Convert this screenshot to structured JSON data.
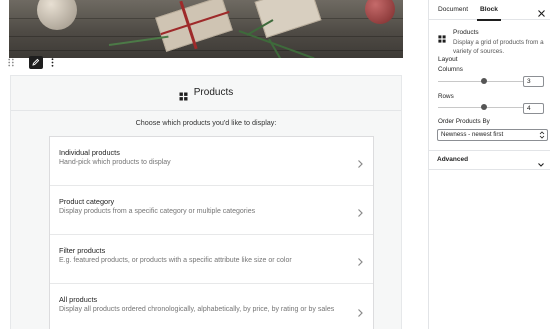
{
  "block": {
    "title": "Products",
    "instruction": "Choose which products you'd like to display:"
  },
  "options": [
    {
      "title": "Individual products",
      "description": "Hand-pick which products to display"
    },
    {
      "title": "Product category",
      "description": "Display products from a specific category or multiple categories"
    },
    {
      "title": "Filter products",
      "description": "E.g. featured products, or products with a specific attribute like size or color"
    },
    {
      "title": "All products",
      "description": "Display all products ordered chronologically, alphabetically, by price, by rating or by sales"
    }
  ],
  "sidebar": {
    "tabs": {
      "document": "Document",
      "block": "Block"
    },
    "block_card": {
      "title": "Products",
      "description": "Display a grid of products from a variety of sources."
    },
    "layout": {
      "title": "Layout",
      "columns_label": "Columns",
      "columns_value": "3",
      "columns_level": 0.45,
      "rows_label": "Rows",
      "rows_value": "4",
      "rows_level": 0.45
    },
    "order": {
      "label": "Order Products By",
      "selected": "Newness - newest first"
    },
    "advanced_label": "Advanced"
  }
}
